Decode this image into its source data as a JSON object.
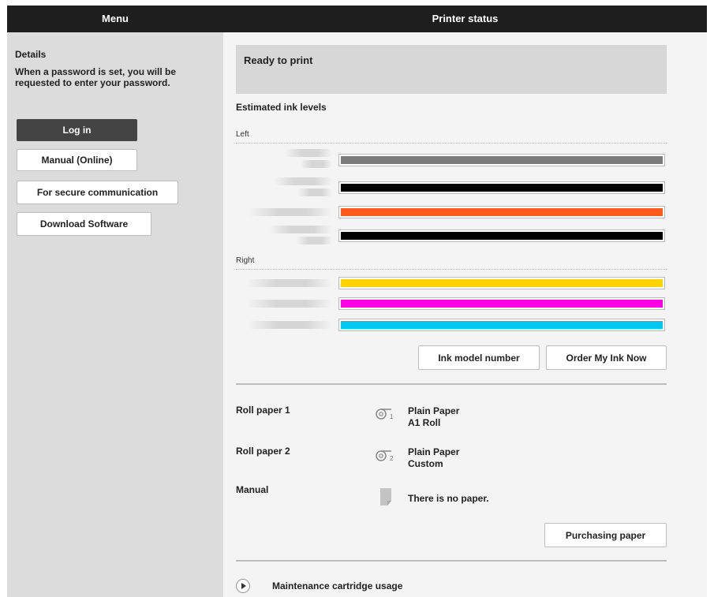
{
  "header": {
    "menu_title": "Menu",
    "status_title": "Printer status"
  },
  "sidebar": {
    "details_heading": "Details",
    "details_text": "When a password is set, you will be requested to enter your password.",
    "login_label": "Log in",
    "manual_label": "Manual (Online)",
    "secure_label": "For secure communication",
    "download_label": "Download Software"
  },
  "status": {
    "message": "Ready to print",
    "ink_heading": "Estimated ink levels",
    "left_label": "Left",
    "right_label": "Right",
    "inks_left": [
      {
        "color": "#7a7a7a",
        "level": 1.0
      },
      {
        "color": "#000000",
        "level": 1.0
      },
      {
        "color": "#ff5a1a",
        "level": 1.0
      },
      {
        "color": "#000000",
        "level": 1.0
      }
    ],
    "inks_right": [
      {
        "color": "#ffd400",
        "level": 1.0
      },
      {
        "color": "#ff00e6",
        "level": 1.0
      },
      {
        "color": "#00c8f0",
        "level": 1.0
      }
    ],
    "ink_model_label": "Ink model number",
    "order_ink_label": "Order My Ink Now"
  },
  "paper": {
    "roll1_label": "Roll paper 1",
    "roll1_type": "Plain Paper",
    "roll1_size": "A1 Roll",
    "roll2_label": "Roll paper 2",
    "roll2_type": "Plain Paper",
    "roll2_size": "Custom",
    "manual_label": "Manual",
    "manual_status": "There is no paper.",
    "purchase_label": "Purchasing paper"
  },
  "maintenance": {
    "label": "Maintenance cartridge usage"
  }
}
